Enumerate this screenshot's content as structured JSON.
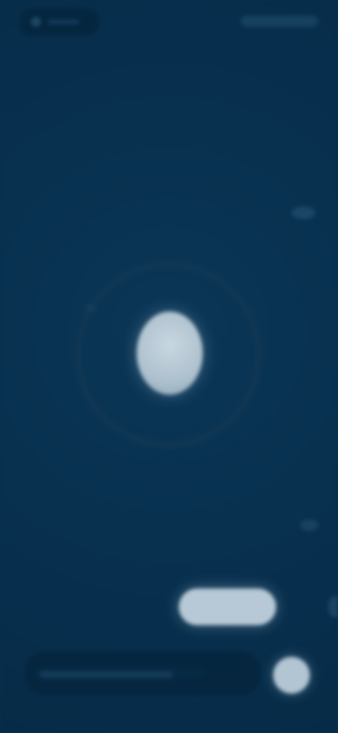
{
  "screen": {
    "background": "#073050",
    "accent": "#b7c9d6"
  },
  "top_bar": {
    "left_control": {
      "icon": "back-icon",
      "label": ""
    },
    "right_control": {
      "label": ""
    }
  },
  "center": {
    "icon": "microphone-icon",
    "status": ""
  },
  "actions": {
    "pill_button_label": ""
  },
  "composer": {
    "placeholder": "",
    "value": ""
  },
  "send_button": {
    "icon": "send-icon",
    "label": ""
  }
}
